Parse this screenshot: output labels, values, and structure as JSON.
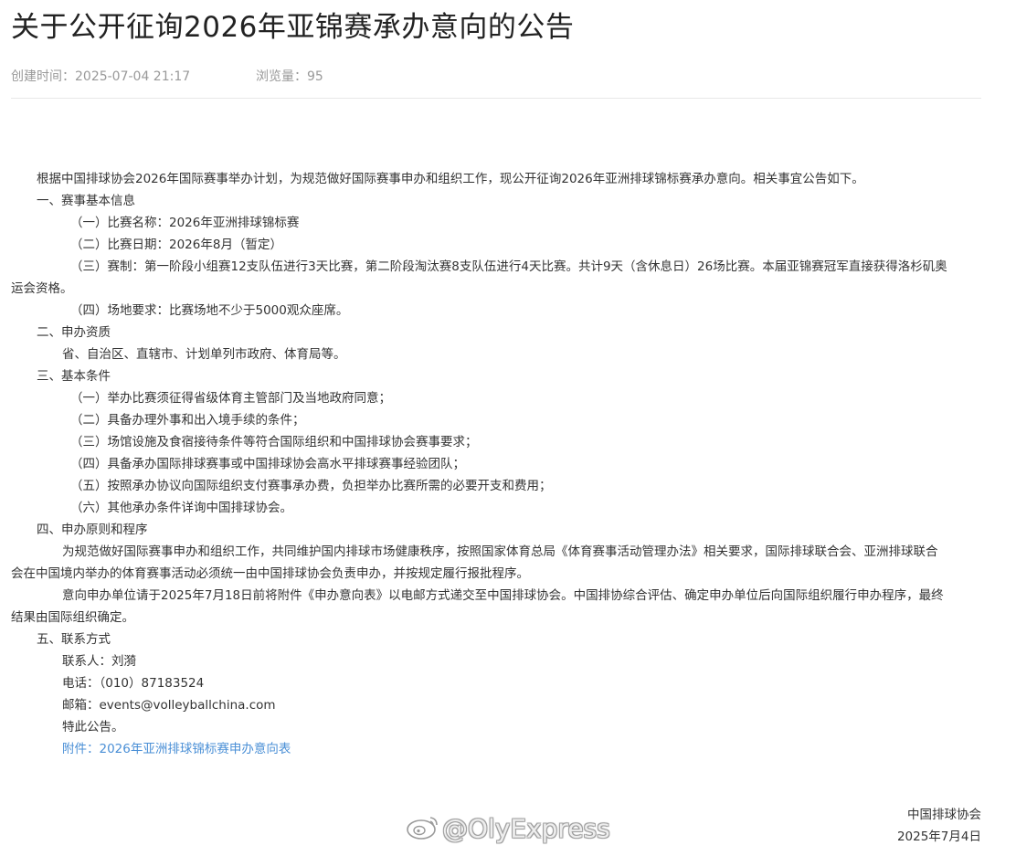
{
  "title": "关于公开征询2026年亚锦赛承办意向的公告",
  "meta": {
    "created": "创建时间：2025-07-04 21:17",
    "views": "浏览量：95"
  },
  "intro": "根据中国排球协会2026年国际赛事举办计划，为规范做好国际赛事申办和组织工作，现公开征询2026年亚洲排球锦标赛承办意向。相关事宜公告如下。",
  "sections": {
    "s1": {
      "heading": "一、赛事基本信息",
      "items": [
        "（一）比赛名称：2026年亚洲排球锦标赛",
        "（二）比赛日期：2026年8月（暂定）",
        "（三）赛制：第一阶段小组赛12支队伍进行3天比赛，第二阶段淘汰赛8支队伍进行4天比赛。共计9天（含休息日）26场比赛。本届亚锦赛冠军直接获得洛杉矶奥",
        "（四）场地要求：比赛场地不少于5000观众座席。"
      ],
      "wrap3": "运会资格。"
    },
    "s2": {
      "heading": "二、申办资质",
      "text": "省、自治区、直辖市、计划单列市政府、体育局等。"
    },
    "s3": {
      "heading": "三、基本条件",
      "items": [
        "（一）举办比赛须征得省级体育主管部门及当地政府同意；",
        "（二）具备办理外事和出入境手续的条件；",
        "（三）场馆设施及食宿接待条件等符合国际组织和中国排球协会赛事要求；",
        "（四）具备承办国际排球赛事或中国排球协会高水平排球赛事经验团队；",
        "（五）按照承办协议向国际组织支付赛事承办费，负担举办比赛所需的必要开支和费用；",
        "（六）其他承办条件详询中国排球协会。"
      ]
    },
    "s4": {
      "heading": "四、申办原则和程序",
      "p1a": "为规范做好国际赛事申办和组织工作，共同维护国内排球市场健康秩序，按照国家体育总局《体育赛事活动管理办法》相关要求，国际排球联合会、亚洲排球联合",
      "p1b": "会在中国境内举办的体育赛事活动必须统一由中国排球协会负责申办，并按规定履行报批程序。",
      "p2a": "意向申办单位请于2025年7月18日前将附件《申办意向表》以电邮方式递交至中国排球协会。中国排协综合评估、确定申办单位后向国际组织履行申办程序，最终",
      "p2b": "结果由国际组织确定。"
    },
    "s5": {
      "heading": "五、联系方式",
      "contact": "联系人：刘漪",
      "phone": "电话：（010）87183524",
      "email": "邮箱：events@volleyballchina.com",
      "closing": "特此公告。",
      "attachment": "附件：2026年亚洲排球锦标赛申办意向表"
    }
  },
  "signature": {
    "org": "中国排球协会",
    "date": "2025年7月4日"
  },
  "watermark": "@OlyExpress",
  "colors": {
    "link": "#4a8fd6",
    "meta": "#999999",
    "text": "#333333"
  }
}
